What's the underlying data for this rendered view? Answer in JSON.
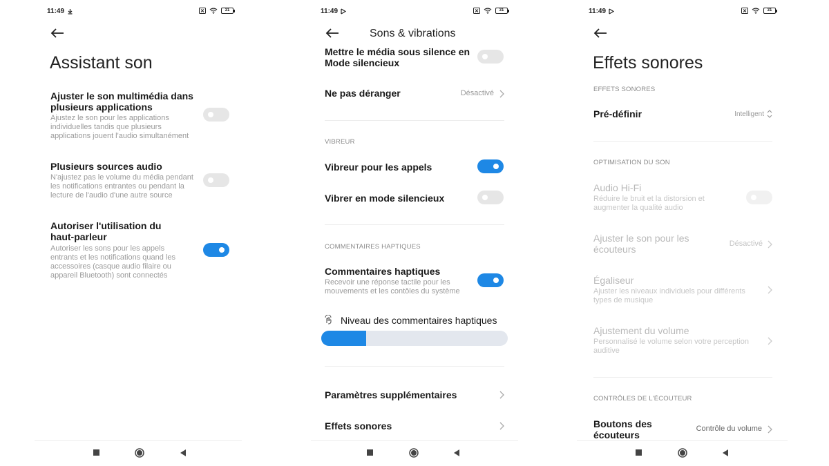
{
  "colors": {
    "accent": "#1e88e5",
    "toggle_off": "#e6e6e6",
    "text_disabled": "#b8b8b8"
  },
  "screen1": {
    "status": {
      "time": "11:49",
      "battery": "31"
    },
    "title": "Assistant son",
    "items": [
      {
        "title": "Ajuster le son multimédia dans plusieurs applications",
        "title_l1": "Ajuster le son multimédia dans",
        "title_l2": "plusieurs applications",
        "sub_l1": "Ajustez le son pour les applications",
        "sub_l2": "individuelles tandis que plusieurs",
        "sub_l3": "applications jouent l'audio simultanément",
        "toggle": false
      },
      {
        "title": "Plusieurs sources audio",
        "sub_l1": "N'ajustez pas le volume du média pendant",
        "sub_l2": "les notifications entrantes ou pendant la",
        "sub_l3": "lecture de l'audio d'une autre source",
        "toggle": false
      },
      {
        "title_l1": "Autoriser l'utilisation du",
        "title_l2": "haut-parleur",
        "sub_l1": "Autoriser les sons pour les appels",
        "sub_l2": "entrants et les notifications quand les",
        "sub_l3": "accessoires (casque audio filaire ou",
        "sub_l4": "appareil Bluetooth) sont connectés",
        "toggle": true
      }
    ]
  },
  "screen2": {
    "status": {
      "time": "11:49",
      "battery": "31"
    },
    "header": "Sons & vibrations",
    "mute_l1": "Mettre le média sous silence en",
    "mute_l2": "Mode silencieux",
    "dnd": {
      "title": "Ne pas déranger",
      "value": "Désactivé"
    },
    "section_vibreur": "VIBREUR",
    "vib_calls": "Vibreur pour les appels",
    "vib_silent": "Vibrer en mode silencieux",
    "section_haptic": "COMMENTAIRES HAPTIQUES",
    "haptic": {
      "title": "Commentaires haptiques",
      "sub_l1": "Recevoir une réponse tactile pour les",
      "sub_l2": "mouvements et les contôles du système"
    },
    "haptic_level": {
      "label": "Niveau des commentaires haptiques",
      "level": 0.24
    },
    "extra": "Paramètres supplémentaires",
    "effects": "Effets sonores"
  },
  "screen3": {
    "status": {
      "time": "11:49",
      "battery": "31"
    },
    "title": "Effets sonores",
    "section_effects": "EFFETS SONORES",
    "predef": {
      "title": "Pré-définir",
      "value": "Intelligent"
    },
    "section_optim": "OPTIMISATION DU SON",
    "hifi": {
      "title": "Audio Hi-Fi",
      "sub_l1": "Réduire le bruit et la distorsion et",
      "sub_l2": "augmenter la qualité audio"
    },
    "headphones": {
      "title_l1": "Ajuster le son pour les",
      "title_l2": "écouteurs",
      "value": "Désactivé"
    },
    "eq": {
      "title": "Égaliseur",
      "sub_l1": "Ajuster les niveaux individuels pour différents",
      "sub_l2": "types de musique"
    },
    "volume_adj": {
      "title": "Ajustement du volume",
      "sub_l1": "Personnalisé le volume selon votre perception",
      "sub_l2": "auditive"
    },
    "section_controls": "CONTRÔLES DE L'ÉCOUTEUR",
    "buttons": {
      "title_l1": "Boutons des",
      "title_l2": "écouteurs",
      "value": "Contrôle du volume"
    }
  },
  "icons": [
    "download-icon",
    "media-icon",
    "sim-icon",
    "wifi-icon",
    "battery-icon",
    "back-arrow-icon",
    "chevron-right-icon",
    "sort-icon",
    "vibrate-icon",
    "recents-icon",
    "home-icon",
    "back-nav-icon"
  ]
}
